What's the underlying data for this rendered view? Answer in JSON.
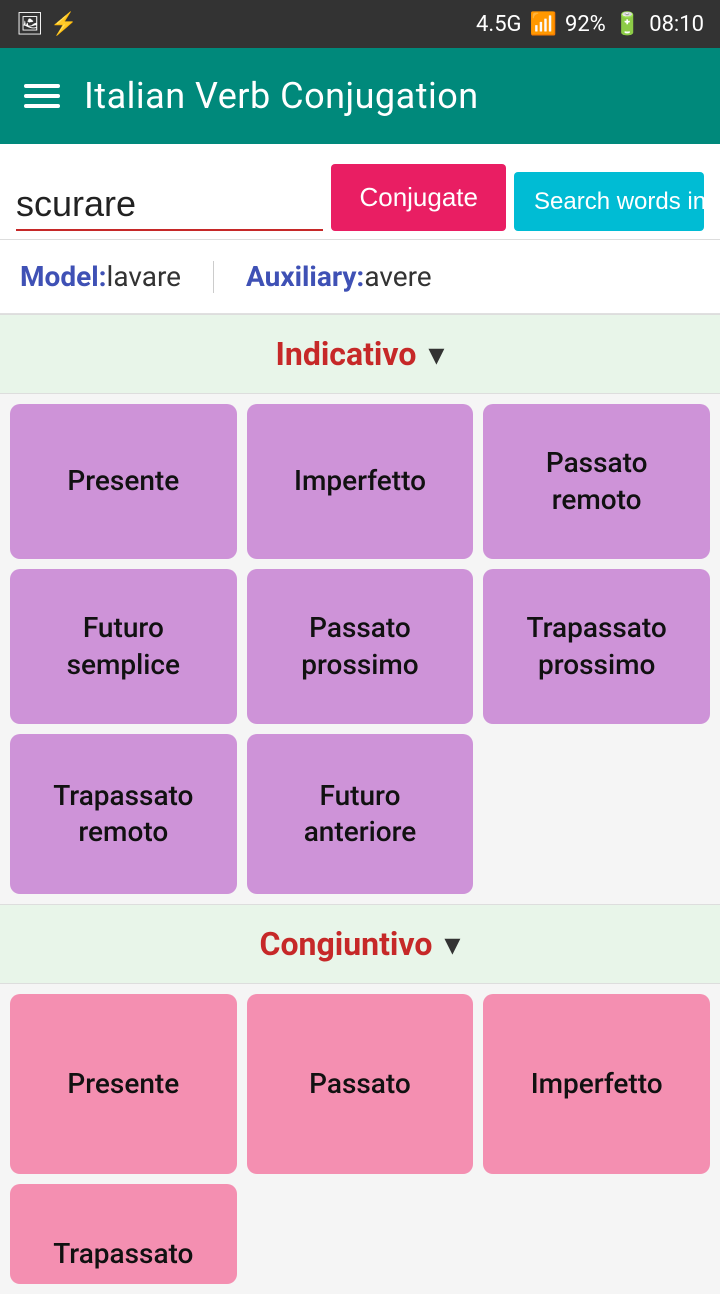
{
  "statusBar": {
    "network": "4.5G",
    "signal": "▲",
    "battery": "92%",
    "time": "08:10"
  },
  "appBar": {
    "title": "Italian Verb Conjugation",
    "menuIcon": "menu-icon"
  },
  "search": {
    "inputValue": "scurare",
    "conjugateLabel": "Conjugate",
    "searchContextLabel": "Search words in Context"
  },
  "meta": {
    "modelLabel": "Model:",
    "modelValue": "lavare",
    "auxiliaryLabel": "Auxiliary:",
    "auxiliaryValue": "avere"
  },
  "indicativo": {
    "sectionTitle": "Indicativo",
    "chevron": "▾",
    "tenses": [
      {
        "label": "Presente"
      },
      {
        "label": "Imperfetto"
      },
      {
        "label": "Passato remoto"
      },
      {
        "label": "Futuro semplice"
      },
      {
        "label": "Passato prossimo"
      },
      {
        "label": "Trapassato prossimo"
      },
      {
        "label": "Trapassato remoto"
      },
      {
        "label": "Futuro anteriore"
      }
    ]
  },
  "congiuntivo": {
    "sectionTitle": "Congiuntivo",
    "chevron": "▾",
    "tenses": [
      {
        "label": "Presente"
      },
      {
        "label": "Passato"
      },
      {
        "label": "Imperfetto"
      },
      {
        "label": "Trapassato"
      }
    ]
  }
}
